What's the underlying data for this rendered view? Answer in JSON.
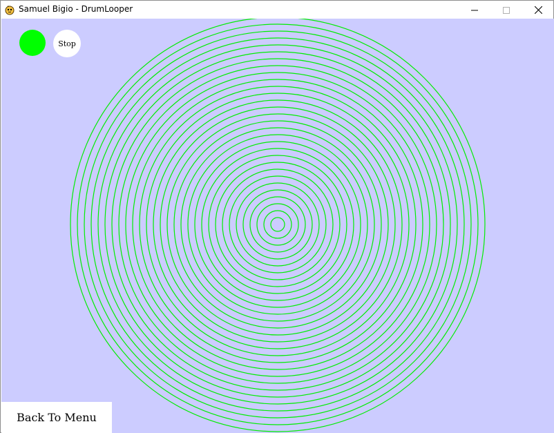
{
  "window": {
    "title": "Samuel Bigio - DrumLooper",
    "app_icon": "python-snake-icon",
    "controls": {
      "minimize_icon": "minimize-icon",
      "maximize_icon": "maximize-icon",
      "close_icon": "close-icon"
    }
  },
  "canvas": {
    "background": "#ccccff",
    "play_indicator": {
      "color": "#00ff00",
      "icon": "green-circle-icon"
    },
    "stop_button": {
      "label": "Stop"
    },
    "rings": {
      "color": "#00ee00",
      "count": 30
    },
    "back_button": {
      "label": "Back To Menu"
    }
  }
}
